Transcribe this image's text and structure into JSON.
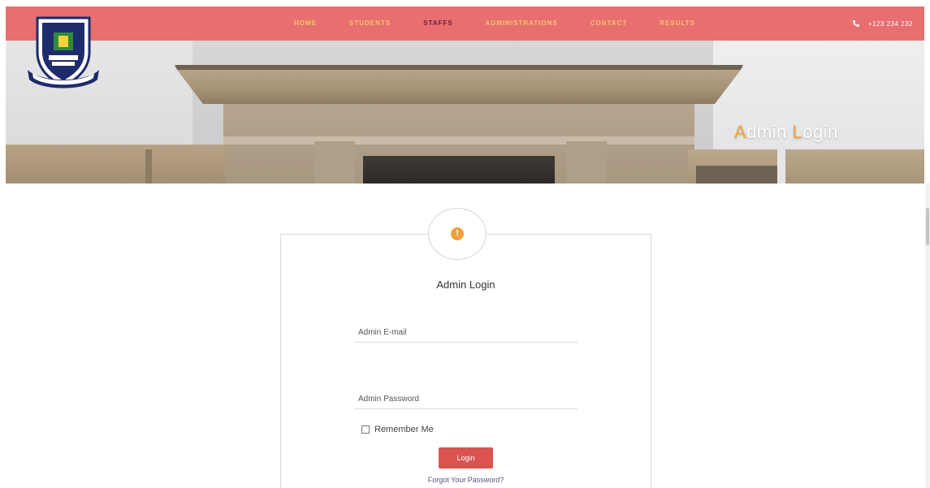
{
  "nav": {
    "items": [
      {
        "label": "HOME",
        "active": false
      },
      {
        "label": "STUDENTS",
        "active": false
      },
      {
        "label": "STAFFS",
        "active": true
      },
      {
        "label": "ADMINISTRATIONS",
        "active": false
      },
      {
        "label": "CONTACT",
        "active": false
      },
      {
        "label": "RESULTS",
        "active": false
      }
    ],
    "phone": "+123 234 232",
    "phone_icon": "phone-icon"
  },
  "banner": {
    "title_first_letter": "A",
    "title_part1": "dmin ",
    "title_second_letter": "L",
    "title_part2": "ogin"
  },
  "login": {
    "badge_icon": "info-icon",
    "badge_glyph": "!",
    "title": "Admin Login",
    "email_placeholder": "Admin E-mail",
    "password_placeholder": "Admin Password",
    "remember_label": "Remember Me",
    "button_label": "Login",
    "forgot_label": "Forgot Your Password?"
  },
  "colors": {
    "nav_bg": "#e86e70",
    "nav_text": "#f2c66c",
    "nav_active": "#6b1f3a",
    "accent": "#f2a33a",
    "button": "#d9534f"
  }
}
